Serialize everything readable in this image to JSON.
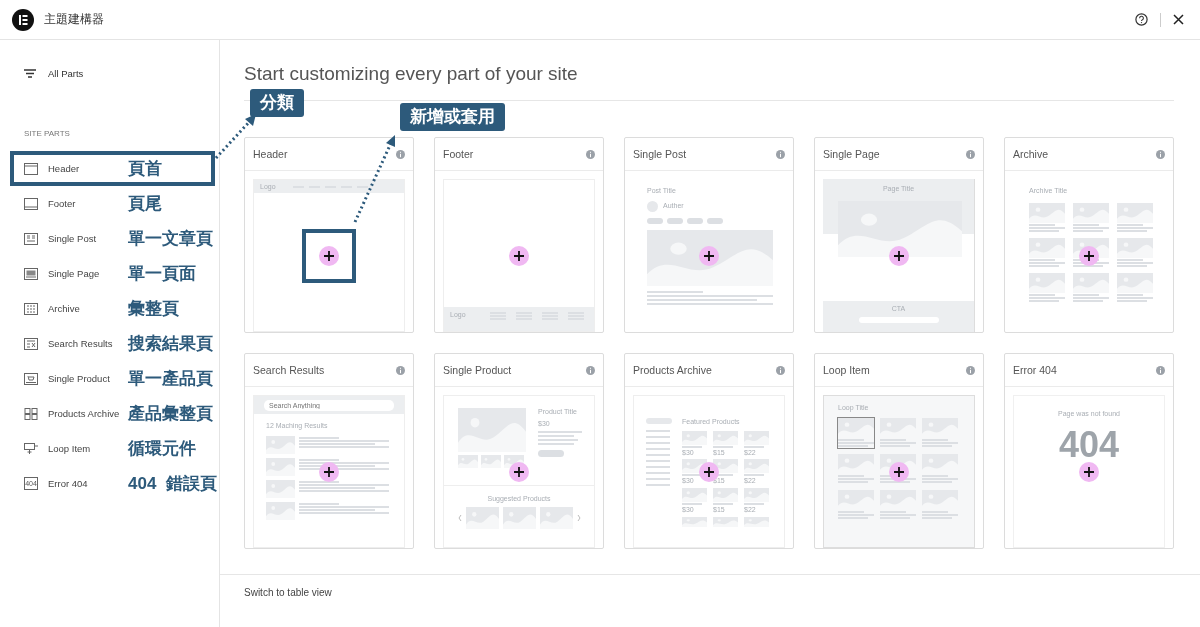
{
  "window": {
    "title": "主題建構器"
  },
  "sidebar": {
    "filter_label": "All Parts",
    "section_title": "SITE PARTS",
    "items": [
      {
        "label": "Header",
        "annotation": "頁首",
        "annotation_frame": true
      },
      {
        "label": "Footer",
        "annotation": "頁尾",
        "annotation_frame": false
      },
      {
        "label": "Single Post",
        "annotation": "單一文章頁",
        "annotation_frame": false
      },
      {
        "label": "Single Page",
        "annotation": "單一頁面",
        "annotation_frame": false
      },
      {
        "label": "Archive",
        "annotation": "彙整頁",
        "annotation_frame": false
      },
      {
        "label": "Search Results",
        "annotation": "搜索結果頁",
        "annotation_frame": false
      },
      {
        "label": "Single Product",
        "annotation": "單一產品頁",
        "annotation_frame": false
      },
      {
        "label": "Products Archive",
        "annotation": "產品彙整頁",
        "annotation_frame": false
      },
      {
        "label": "Loop Item",
        "annotation": "循環元件",
        "annotation_frame": false
      },
      {
        "label": "Error 404",
        "icon_text": "404",
        "annotation": "404  錯誤頁",
        "annotation_frame": false
      }
    ]
  },
  "main": {
    "heading": "Start customizing every part of your site",
    "cards": [
      {
        "title": "Header",
        "annotation_frame": true,
        "preview": {
          "kind": "header",
          "logo": "Logo"
        }
      },
      {
        "title": "Footer",
        "annotation_frame": false,
        "preview": {
          "kind": "footer",
          "logo": "Logo"
        }
      },
      {
        "title": "Single Post",
        "annotation_frame": false,
        "preview": {
          "kind": "post",
          "title": "Post Title",
          "author": "Auther"
        }
      },
      {
        "title": "Single Page",
        "annotation_frame": false,
        "preview": {
          "kind": "page",
          "title": "Page Title",
          "cta": "CTA"
        }
      },
      {
        "title": "Archive",
        "annotation_frame": false,
        "preview": {
          "kind": "archive",
          "title": "Archive Title"
        }
      },
      {
        "title": "Search Results",
        "annotation_frame": false,
        "preview": {
          "kind": "search",
          "placeholder": "Search Anything",
          "results": "12 Maching Results"
        }
      },
      {
        "title": "Single Product",
        "annotation_frame": false,
        "preview": {
          "kind": "product",
          "title": "Product Title",
          "price": "$30",
          "suggested": "Suggested Products"
        }
      },
      {
        "title": "Products Archive",
        "annotation_frame": false,
        "preview": {
          "kind": "products",
          "title": "Featured Products",
          "prices": [
            [
              "$30",
              "$15",
              "$22"
            ],
            [
              "$30",
              "$15",
              "$22"
            ],
            [
              "$30",
              "$15",
              "$22"
            ]
          ]
        }
      },
      {
        "title": "Loop Item",
        "annotation_frame": false,
        "preview": {
          "kind": "loop",
          "title": "Loop Title"
        }
      },
      {
        "title": "Error 404",
        "annotation_frame": false,
        "preview": {
          "kind": "error",
          "message": "Page was not found",
          "code": "404"
        }
      }
    ],
    "footer_link": "Switch to table view"
  },
  "annotations": [
    {
      "text": "分類"
    },
    {
      "text": "新增或套用"
    }
  ]
}
